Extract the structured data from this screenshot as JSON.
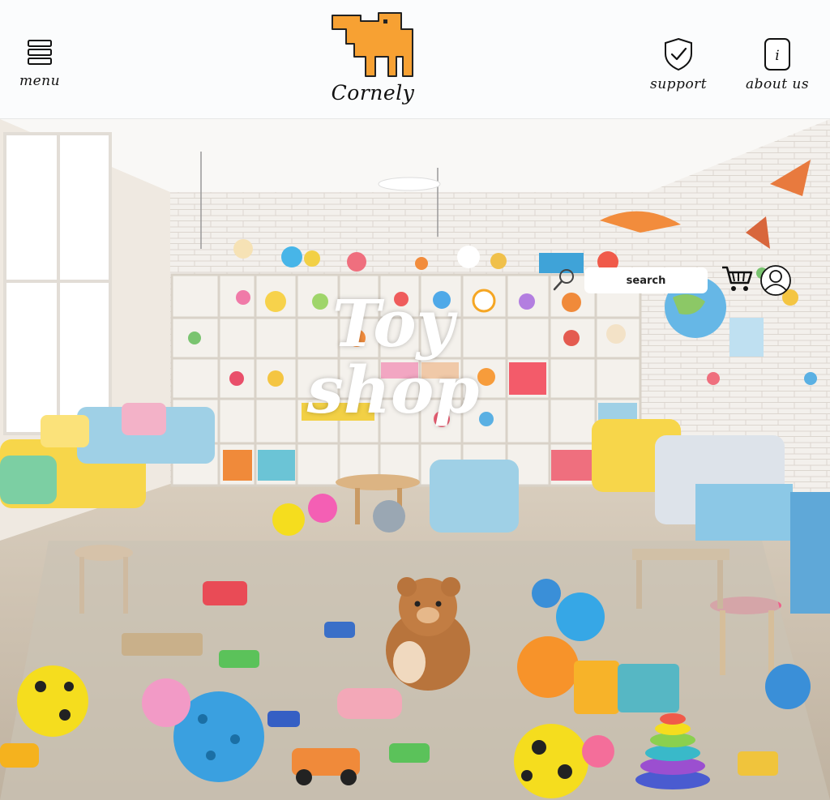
{
  "header": {
    "menu_label": "menu",
    "logo_text": "Cornely",
    "support_label": "support",
    "about_label": "about us",
    "about_icon_glyph": "i"
  },
  "hero": {
    "title_line1": "Toy",
    "title_line2": "shop",
    "search_placeholder": "search"
  },
  "colors": {
    "logo_orange": "#f7a133",
    "title_text": "#ffffff",
    "header_bg": "#fbfcfd"
  },
  "icons": [
    "hamburger-icon",
    "shield-check-icon",
    "info-icon",
    "search-icon",
    "cart-icon",
    "user-icon"
  ]
}
